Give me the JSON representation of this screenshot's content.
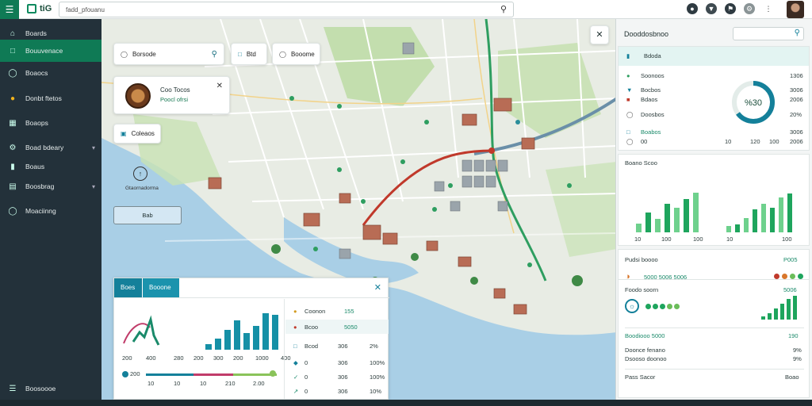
{
  "app": {
    "title": "tiG"
  },
  "search": {
    "value": "fadd_pfouanu",
    "placeholder": ""
  },
  "colors": {
    "brand": "#0f7a55",
    "sidebar": "#23313a",
    "accent": "#14809a",
    "bar": "#1ea55d",
    "route": "#c0392b"
  },
  "sidebar": {
    "items": [
      {
        "label": "Boards",
        "icon": "house-icon"
      },
      {
        "label": "Bouuvenace",
        "icon": "square-icon"
      },
      {
        "label": "Boaocs",
        "icon": "compass-icon"
      },
      {
        "label": "Donbt ftetos",
        "icon": "coin-icon"
      },
      {
        "label": "Boaops",
        "icon": "grid-icon"
      },
      {
        "label": "Boad bdeary",
        "icon": "gear-icon"
      },
      {
        "label": "Boaus",
        "icon": "doc-icon"
      },
      {
        "label": "Boosbrag",
        "icon": "book-icon"
      },
      {
        "label": "Moaciinng",
        "icon": "pin-icon"
      }
    ],
    "footer_label": "Boosoooe"
  },
  "map": {
    "search_pill": "Borsode",
    "pill_2": "Btd",
    "pill_3": "Booome",
    "popup_title": "Coo Tocos",
    "popup_subtitle": "Poocl ofrsi",
    "layer_pill": "Coleaos",
    "compass_label": "Gtaornadorma",
    "select_label": "Bab"
  },
  "bottom_panel": {
    "tab_1": "Boes",
    "tab_2": "Booone",
    "axis_left": [
      "200",
      "400",
      "280",
      "200"
    ],
    "axis_right": [
      "300",
      "200",
      "1000",
      "400"
    ],
    "axis_bottom": [
      "10",
      "10",
      "10",
      "210",
      "2.00"
    ],
    "list": [
      {
        "label": "Coonon",
        "value": "155"
      },
      {
        "label": "Bcoo",
        "value": "5050"
      },
      {
        "label": "Bcod",
        "value": "306",
        "pct": "2%"
      },
      {
        "label": "0",
        "value": "306",
        "pct": "100%"
      },
      {
        "label": "0",
        "value": "306",
        "pct": "100%"
      },
      {
        "label": "0",
        "value": "306",
        "pct": "10%"
      }
    ],
    "bars": [
      0.15,
      0.3,
      0.55,
      0.8,
      0.45,
      0.65,
      1.0,
      0.95
    ]
  },
  "right_panel": {
    "header": "Dooddosbnoo",
    "tab_label": "Bdoda",
    "stats": [
      {
        "label": "Soonoos",
        "value": "1306"
      },
      {
        "label": "Bocbos",
        "value": "3006"
      },
      {
        "label": "Bdaos",
        "value": "2006"
      },
      {
        "label": "Doosbos",
        "value": "20%"
      },
      {
        "label": "Boabos",
        "value": "3006"
      },
      {
        "label": "00",
        "value": "2006"
      }
    ],
    "gauge_label": "%30",
    "gauge_value": 0.65,
    "stat_mid": [
      "10",
      "120",
      "100"
    ],
    "chart_title": "Boano Scoo",
    "chart_left_bars": [
      0.2,
      0.45,
      0.3,
      0.65,
      0.55,
      0.75,
      0.9
    ],
    "chart_right_bars": [
      0.15,
      0.2,
      0.35,
      0.55,
      0.7,
      0.6,
      0.85,
      0.95
    ],
    "chart_axis": [
      "10",
      "100",
      "100",
      "10",
      "100"
    ],
    "section2_title": "Pudsi boooo",
    "section2_val": "P005",
    "section2_row": "5000 5006 5006",
    "section3_title": "Foodo soorn",
    "section3_val": "5006",
    "section3_row1": "Boodiooo 5000",
    "section3_row1_val": "190",
    "section3_row2": "Doonce fenano",
    "section3_row2_val": "9%",
    "section3_row3": "Dsooso doonoo",
    "section3_row3_val": "9%",
    "footer": "Pass Sacor",
    "footer_val": "Boao"
  }
}
